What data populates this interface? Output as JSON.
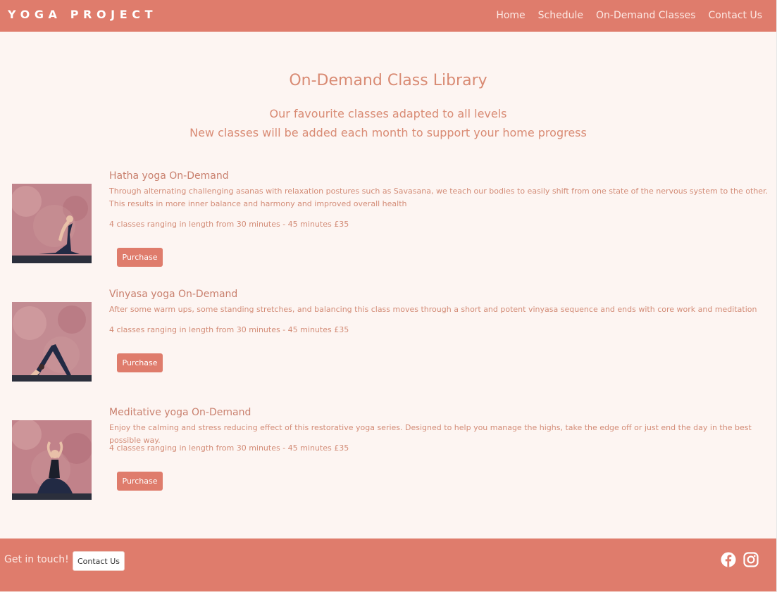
{
  "header": {
    "brand": "YOGA PROJECT",
    "nav": [
      "Home",
      "Schedule",
      "On-Demand Classes",
      "Contact Us"
    ]
  },
  "intro": {
    "title": "On-Demand Class Library",
    "subtitle1": "Our favourite classes adapted to all levels",
    "subtitle2": "New classes will be added each month to support your home progress"
  },
  "classes": [
    {
      "title": "Hatha yoga On-Demand",
      "description": "Through alternating challenging asanas with relaxation postures such as Savasana, we teach our bodies to easily shift from one state of the nervous system to the other. This results in more inner balance and harmony and improved overall health",
      "price": "4 classes ranging in length from 30 minutes - 45 minutes £35",
      "button": "Purchase"
    },
    {
      "title": "Vinyasa yoga On-Demand",
      "description": "After some warm ups, some standing stretches, and balancing this class moves through a short and potent vinyasa sequence and ends with core work and meditation",
      "price": "4 classes ranging in length from 30 minutes - 45 minutes £35",
      "button": "Purchase"
    },
    {
      "title": "Meditative yoga On-Demand",
      "description": "Enjoy the calming and stress reducing effect of this restorative yoga series. Designed to help you manage the highs, take the edge off or just end the day in the best possible way.",
      "price": "4 classes ranging in length from 30 minutes - 45 minutes £35",
      "button": "Purchase"
    }
  ],
  "footer": {
    "text": "Get in touch!",
    "button": "Contact Us",
    "icons": [
      "facebook-icon",
      "instagram-icon"
    ]
  },
  "colors": {
    "accent": "#df7c6c",
    "background": "#fdf5f2",
    "text": "#d98b74"
  }
}
